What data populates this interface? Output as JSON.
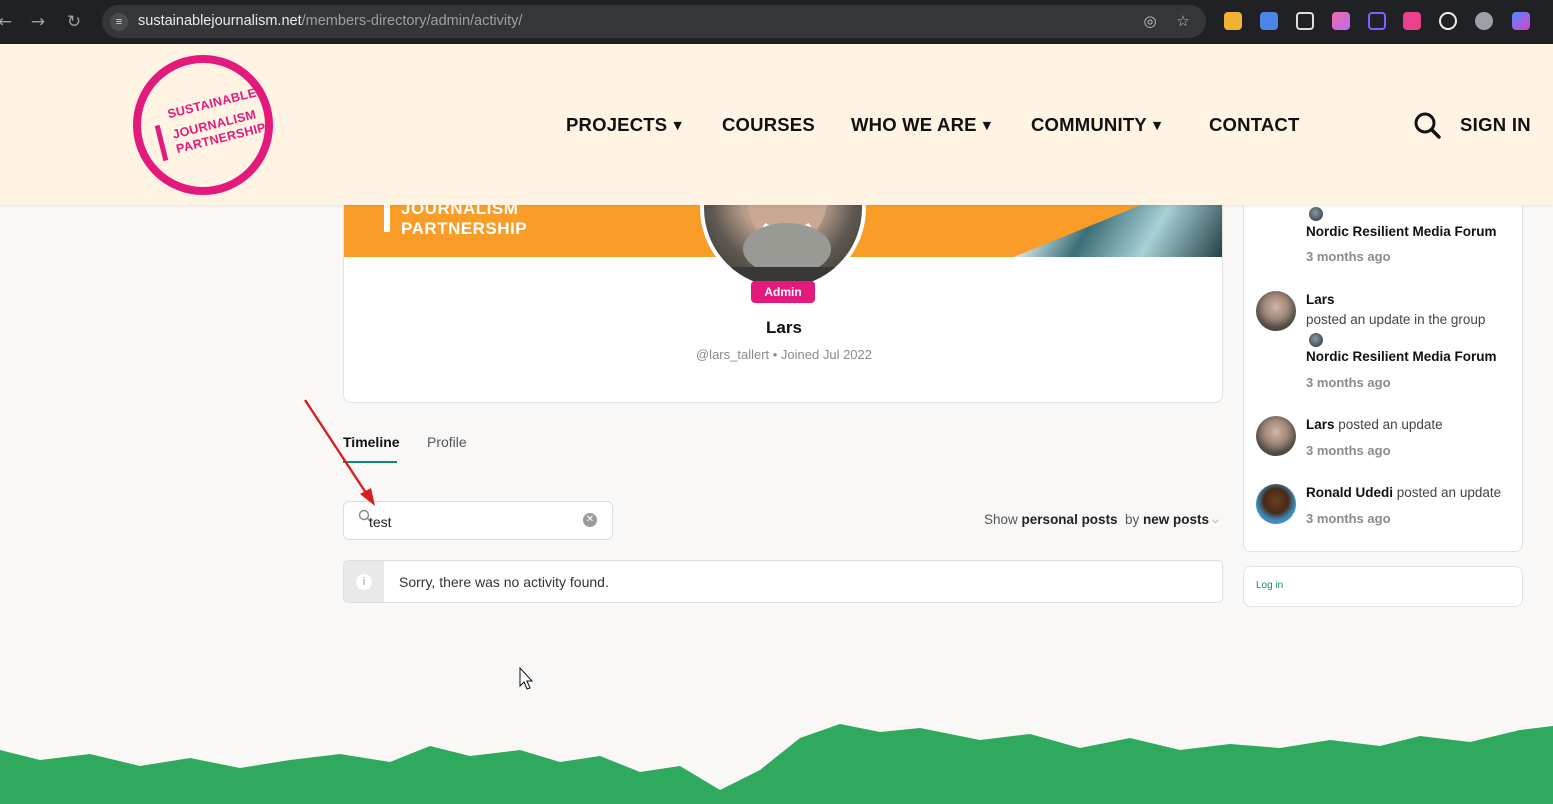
{
  "browser": {
    "url_domain": "sustainablejournalism.net",
    "url_path": "/members-directory/admin/activity/",
    "back_icon": "back-arrow-icon",
    "forward_icon": "forward-arrow-icon",
    "reload_icon": "reload-icon"
  },
  "site": {
    "logo_line1": "SUSTAINABLE",
    "logo_line2": "JOURNALISM",
    "logo_line3": "PARTNERSHIP",
    "brand_color": "#e4197c",
    "nav": [
      {
        "label": "PROJECTS",
        "has_caret": true
      },
      {
        "label": "COURSES",
        "has_caret": false
      },
      {
        "label": "WHO WE ARE",
        "has_caret": true
      },
      {
        "label": "COMMUNITY",
        "has_caret": true
      },
      {
        "label": "CONTACT",
        "has_caret": false
      }
    ],
    "sign_in": "SIGN IN"
  },
  "profile": {
    "cover_line1": "JOURNALISM",
    "cover_line2": "PARTNERSHIP",
    "badge": "Admin",
    "name": "Lars",
    "meta": "@lars_tallert • Joined Jul 2022"
  },
  "tabs": [
    {
      "label": "Timeline",
      "active": true
    },
    {
      "label": "Profile",
      "active": false
    }
  ],
  "search": {
    "value": "test"
  },
  "filters": {
    "show_prefix": "Show",
    "show_value": "personal posts",
    "order_prefix": "by",
    "order_value": "new posts"
  },
  "notice": {
    "text": "Sorry, there was no activity found."
  },
  "activity": {
    "items": [
      {
        "group": "Nordic Resilient Media Forum",
        "time": "3 months ago"
      },
      {
        "name": "Lars",
        "action": "posted an update in the group",
        "group": "Nordic Resilient Media Forum",
        "time": "3 months ago"
      },
      {
        "name": "Lars",
        "action": "posted an update",
        "time": "3 months ago"
      },
      {
        "name": "Ronald Udedi",
        "action": "posted an update",
        "time": "3 months ago"
      }
    ]
  },
  "login": {
    "label": "Log in"
  },
  "colors": {
    "header_bg": "#fff3e4",
    "accent_green": "#0b8e6b",
    "footer_green": "#2fa95d",
    "cover_orange": "#fa9d28"
  }
}
